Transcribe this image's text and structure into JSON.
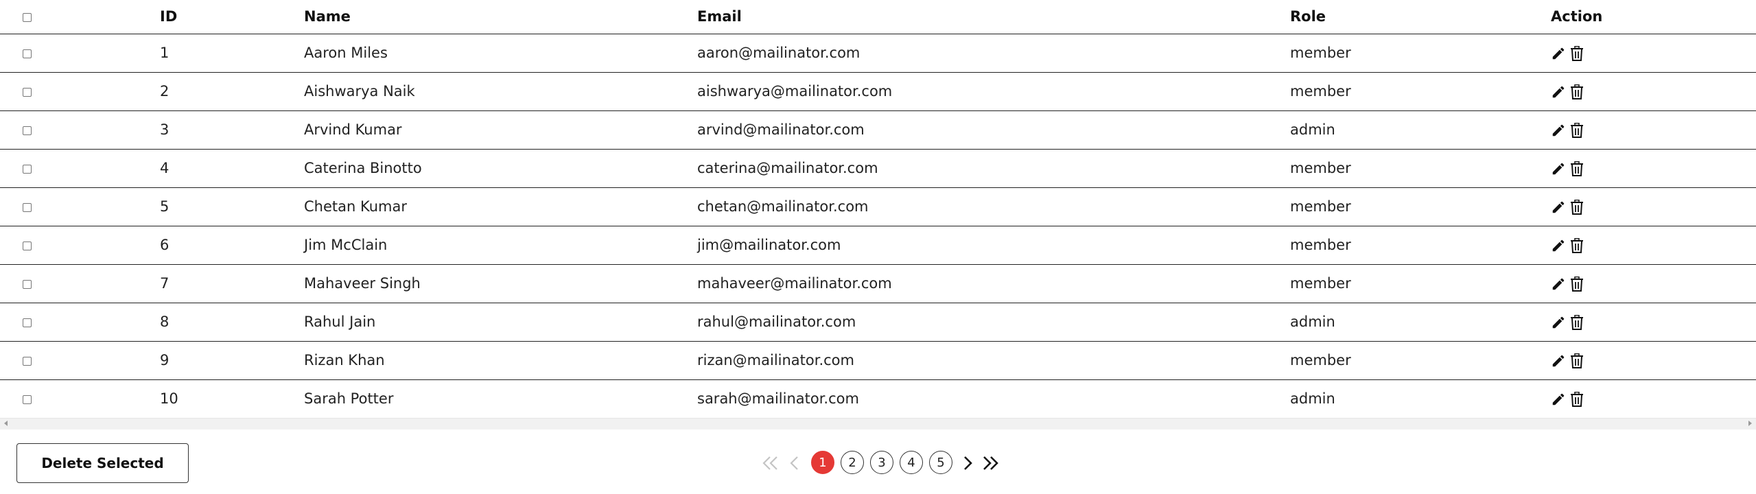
{
  "table": {
    "headers": {
      "id": "ID",
      "name": "Name",
      "email": "Email",
      "role": "Role",
      "action": "Action"
    },
    "rows": [
      {
        "id": "1",
        "name": "Aaron Miles",
        "email": "aaron@mailinator.com",
        "role": "member"
      },
      {
        "id": "2",
        "name": "Aishwarya Naik",
        "email": "aishwarya@mailinator.com",
        "role": "member"
      },
      {
        "id": "3",
        "name": "Arvind Kumar",
        "email": "arvind@mailinator.com",
        "role": "admin"
      },
      {
        "id": "4",
        "name": "Caterina Binotto",
        "email": "caterina@mailinator.com",
        "role": "member"
      },
      {
        "id": "5",
        "name": "Chetan Kumar",
        "email": "chetan@mailinator.com",
        "role": "member"
      },
      {
        "id": "6",
        "name": "Jim McClain",
        "email": "jim@mailinator.com",
        "role": "member"
      },
      {
        "id": "7",
        "name": "Mahaveer Singh",
        "email": "mahaveer@mailinator.com",
        "role": "member"
      },
      {
        "id": "8",
        "name": "Rahul Jain",
        "email": "rahul@mailinator.com",
        "role": "admin"
      },
      {
        "id": "9",
        "name": "Rizan Khan",
        "email": "rizan@mailinator.com",
        "role": "member"
      },
      {
        "id": "10",
        "name": "Sarah Potter",
        "email": "sarah@mailinator.com",
        "role": "admin"
      }
    ],
    "row_action_icons": [
      "edit-icon",
      "trash-icon"
    ]
  },
  "footer": {
    "delete_selected_label": "Delete Selected"
  },
  "pagination": {
    "pages": [
      "1",
      "2",
      "3",
      "4",
      "5"
    ],
    "current_page": "1",
    "icons": [
      "first-page-icon",
      "previous-page-icon",
      "next-page-icon",
      "last-page-icon"
    ]
  },
  "colors": {
    "active_page": "#e53935",
    "border": "#222222",
    "scrollbar": "#f1f1f1"
  }
}
